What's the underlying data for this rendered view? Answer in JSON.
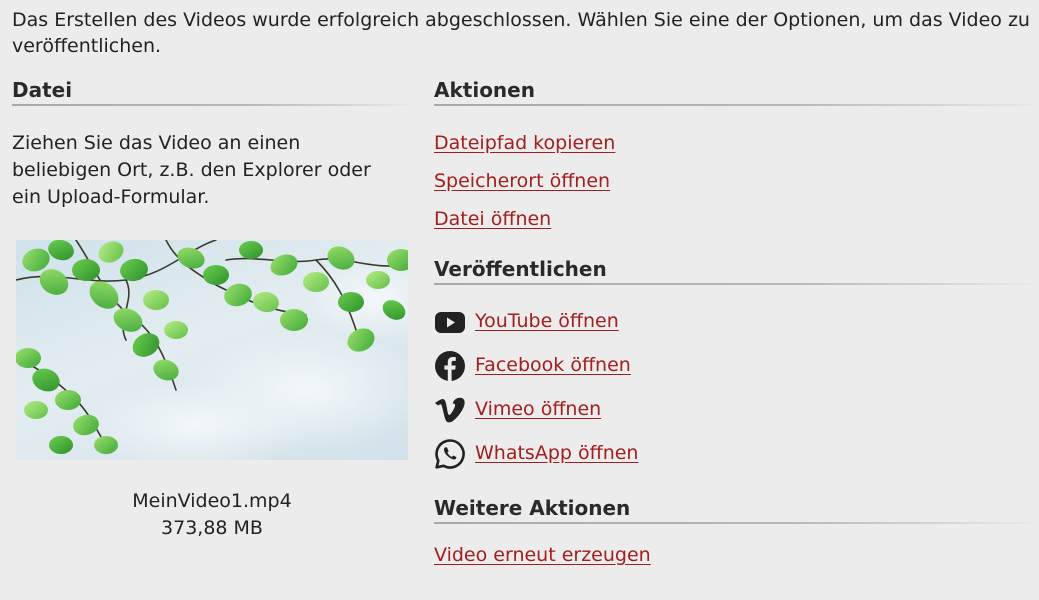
{
  "intro": {
    "message": "Das Erstellen des Videos wurde erfolgreich abgeschlossen. Wählen Sie eine der Optionen, um das Video zu veröffentlichen."
  },
  "file": {
    "title": "Datei",
    "description": "Ziehen Sie das Video an einen beliebigen Ort, z.B. den Explorer oder ein Upload-Formular.",
    "filename": "MeinVideo1.mp4",
    "size": "373,88 MB"
  },
  "actions": {
    "title": "Aktionen",
    "copy_path": "Dateipfad kopieren",
    "open_location": "Speicherort öffnen",
    "open_file": "Datei öffnen"
  },
  "publish": {
    "title": "Veröffentlichen",
    "youtube": "YouTube öffnen",
    "facebook": "Facebook öffnen",
    "vimeo": "Vimeo öffnen",
    "whatsapp": "WhatsApp öffnen"
  },
  "more": {
    "title": "Weitere Aktionen",
    "regenerate": "Video erneut erzeugen"
  },
  "colors": {
    "link": "#a31e1e",
    "background": "#ececec",
    "text": "#222222"
  }
}
